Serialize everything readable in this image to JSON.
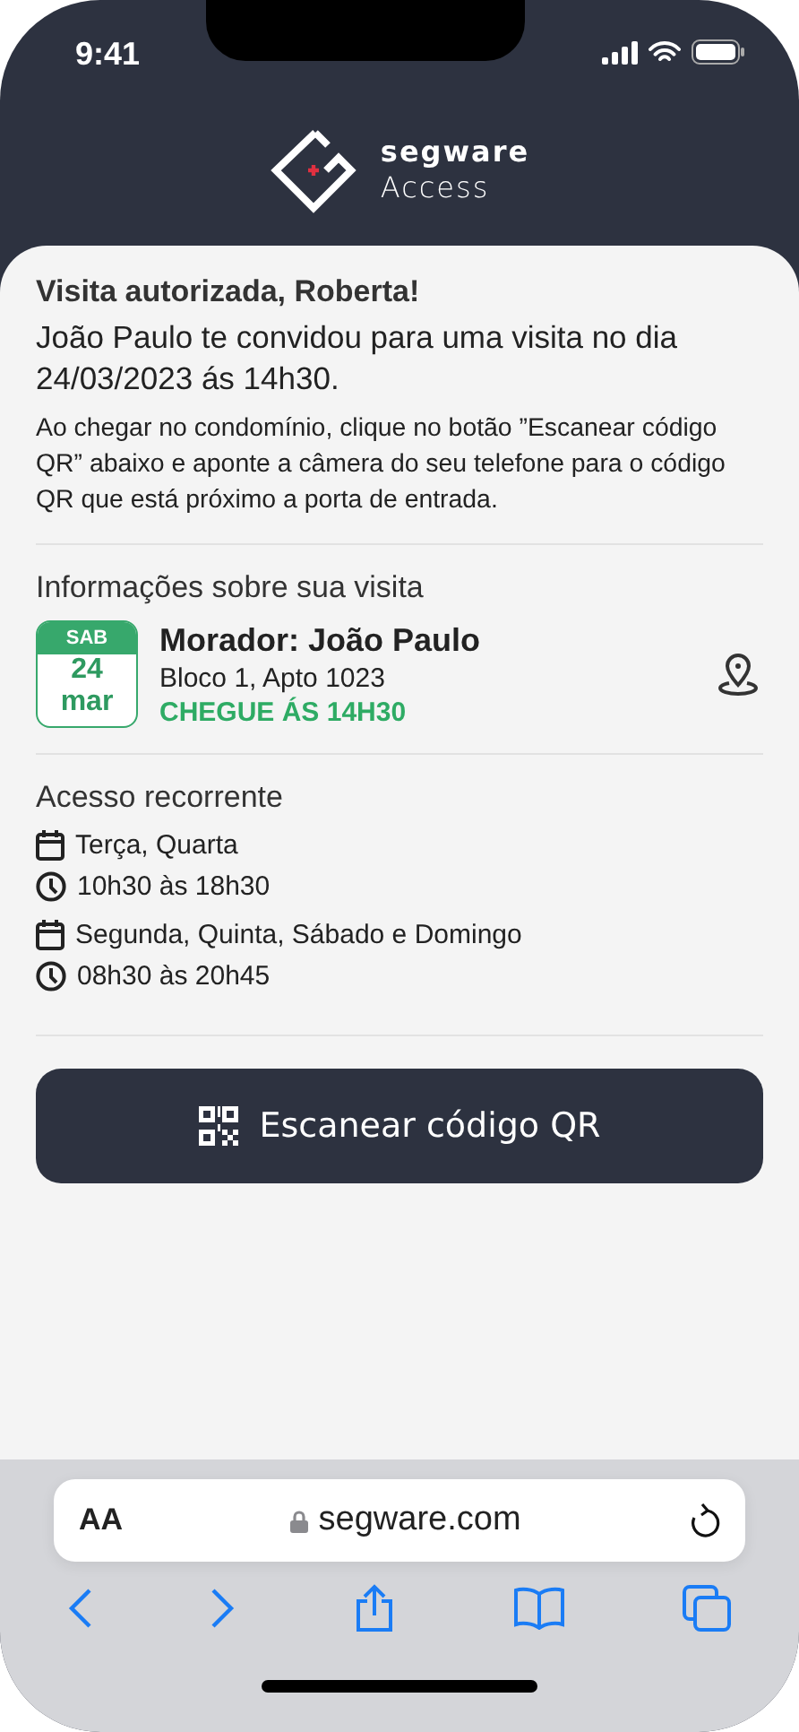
{
  "status_bar": {
    "time": "9:41"
  },
  "logo": {
    "name": "segware",
    "product": "Access"
  },
  "greeting": {
    "title": "Visita autorizada, Roberta!",
    "invite": "João Paulo te convidou para uma visita no dia 24/03/2023 ás 14h30.",
    "instructions": "Ao chegar no condomínio, clique no botão ”Escanear código QR” abaixo e aponte a câmera do seu telefone para o código QR que está próximo a porta de entrada."
  },
  "visit": {
    "heading": "Informações sobre sua visita",
    "date": {
      "weekday": "SAB",
      "day": "24",
      "month": "mar"
    },
    "resident": "Morador: João Paulo",
    "unit": "Bloco 1, Apto 1023",
    "arrival": "CHEGUE ÁS 14H30"
  },
  "recurring": {
    "heading": "Acesso recorrente",
    "schedules": [
      {
        "days": "Terça, Quarta",
        "hours": "10h30 às 18h30"
      },
      {
        "days": "Segunda, Quinta, Sábado e Domingo",
        "hours": "08h30 às 20h45"
      }
    ]
  },
  "scan_button": {
    "label": "Escanear código QR"
  },
  "browser": {
    "text_size": "AA",
    "url": "segware.com"
  }
}
